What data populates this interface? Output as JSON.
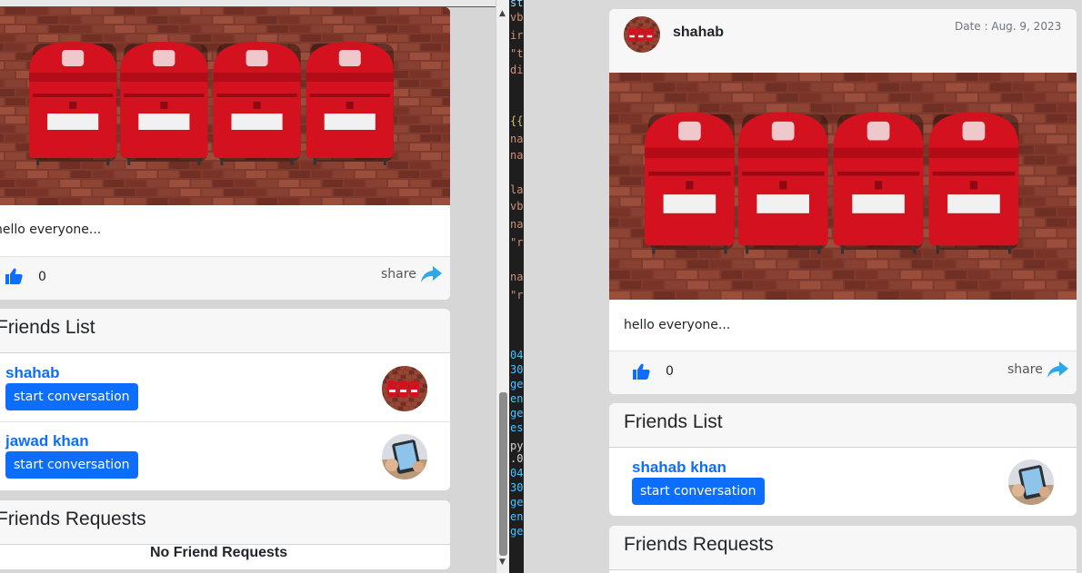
{
  "left_window": {
    "post": {
      "text": "hello everyone...",
      "like_count": "0",
      "share_label": "share"
    },
    "friends_list": {
      "title": "Friends List",
      "friends": [
        {
          "name": "shahab",
          "button": "start conversation",
          "avatar": "mailbox-photo"
        },
        {
          "name": "jawad khan",
          "button": "start conversation",
          "avatar": "tablet-photo"
        }
      ]
    },
    "friend_requests": {
      "title": "Friends Requests",
      "empty_text": "No Friend Requests"
    }
  },
  "code_fragments": [
    {
      "text": "sta",
      "color": "#9cdcfe"
    },
    {
      "text": "vb",
      "color": "#ce9178"
    },
    {
      "text": "ir",
      "color": "#ce9178"
    },
    {
      "text": "\"t",
      "color": "#ce9178"
    },
    {
      "text": "di",
      "color": "#ce9178"
    },
    {
      "text": "{{",
      "color": "#d7ba7d"
    },
    {
      "text": "na",
      "color": "#ce9178"
    },
    {
      "text": "na",
      "color": "#ce9178"
    },
    {
      "text": "la",
      "color": "#ce9178"
    },
    {
      "text": "vb",
      "color": "#ce9178"
    },
    {
      "text": "na",
      "color": "#ce9178"
    },
    {
      "text": "\"r",
      "color": "#ce9178"
    },
    {
      "text": "na",
      "color": "#ce9178"
    },
    {
      "text": "\"r",
      "color": "#ce9178"
    },
    {
      "text": "04",
      "color": "#4fc1ff"
    },
    {
      "text": "30",
      "color": "#4fc1ff"
    },
    {
      "text": "ge",
      "color": "#4fc1ff"
    },
    {
      "text": "en",
      "color": "#4fc1ff"
    },
    {
      "text": "ge",
      "color": "#4fc1ff"
    },
    {
      "text": "es",
      "color": "#4fc1ff"
    },
    {
      "text": "py",
      "color": "#d4d4d4"
    },
    {
      "text": ".0",
      "color": "#d4d4d4"
    },
    {
      "text": "04",
      "color": "#4fc1ff"
    },
    {
      "text": "30",
      "color": "#4fc1ff"
    },
    {
      "text": "ge",
      "color": "#4fc1ff"
    },
    {
      "text": "en",
      "color": "#4fc1ff"
    },
    {
      "text": "ge",
      "color": "#4fc1ff"
    }
  ],
  "right_window": {
    "post": {
      "author": "shahab",
      "date": "Date : Aug. 9, 2023",
      "text": "hello everyone...",
      "like_count": "0",
      "share_label": "share"
    },
    "friends_list": {
      "title": "Friends List",
      "friends": [
        {
          "name": "shahab khan",
          "button": "start conversation",
          "avatar": "tablet-photo"
        }
      ]
    },
    "friend_requests": {
      "title": "Friends Requests"
    }
  },
  "colors": {
    "accent_blue": "#0d6efd",
    "share_blue": "#2ca8e8",
    "card_bg": "#ffffff",
    "footer_bg": "#f7f7f7"
  }
}
